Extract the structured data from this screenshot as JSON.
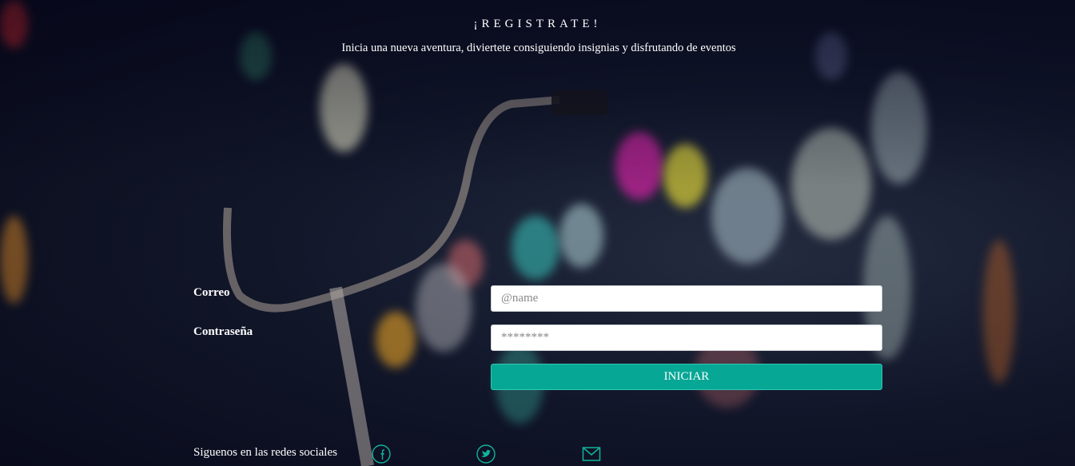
{
  "header": {
    "title": "¡REGISTRATE!",
    "subtitle": "Inicia una nueva aventura, diviertete consiguiendo insignias y disfrutando de eventos"
  },
  "form": {
    "email_label": "Correo",
    "email_placeholder": "@name",
    "password_label": "Contraseña",
    "password_placeholder": "********",
    "submit_label": "INICIAR"
  },
  "footer": {
    "social_text": "Siguenos en las redes sociales",
    "icons": [
      "facebook-icon",
      "twitter-icon",
      "mail-icon"
    ]
  },
  "colors": {
    "accent": "#06a795",
    "icon": "#11b39c",
    "text": "#ffffff"
  }
}
